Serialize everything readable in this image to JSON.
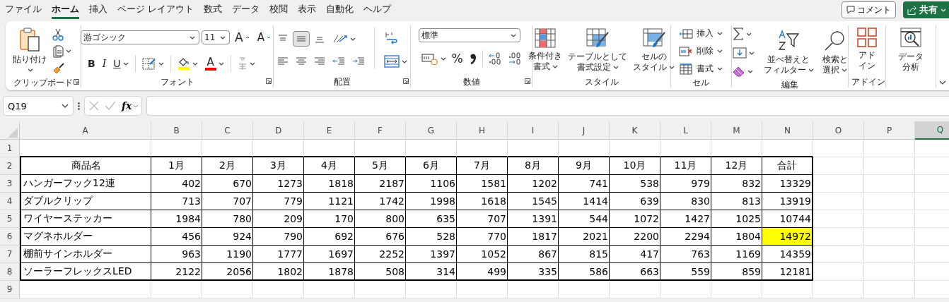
{
  "menu_tabs": [
    {
      "label": "ファイル",
      "selected": false
    },
    {
      "label": "ホーム",
      "selected": true
    },
    {
      "label": "挿入",
      "selected": false
    },
    {
      "label": "ページ レイアウト",
      "selected": false
    },
    {
      "label": "数式",
      "selected": false
    },
    {
      "label": "データ",
      "selected": false
    },
    {
      "label": "校閲",
      "selected": false
    },
    {
      "label": "表示",
      "selected": false
    },
    {
      "label": "自動化",
      "selected": false
    },
    {
      "label": "ヘルプ",
      "selected": false
    }
  ],
  "comment_button": {
    "label": "コメント"
  },
  "share_button": {
    "label": "共有"
  },
  "ribbon": [
    {
      "kind": "clipboard",
      "label": "クリップボード",
      "paste": "貼り付け"
    },
    {
      "kind": "font",
      "label": "フォント",
      "font_name": "游ゴシック",
      "font_size": "11",
      "grow": "A",
      "shrink": "A",
      "bold": "B",
      "italic": "I",
      "underline": "U",
      "fill_color": {
        "color": "#ffff00"
      },
      "font_color": {
        "glyph": "A",
        "color": "#ff0000"
      }
    },
    {
      "kind": "alignment",
      "label": "配置",
      "vertical": [
        {
          "selected": false
        },
        {
          "selected": true
        },
        {
          "selected": false
        }
      ]
    },
    {
      "kind": "number",
      "label": "数値",
      "format": "標準",
      "percent": "%"
    },
    {
      "kind": "styles",
      "label": "スタイル",
      "buttons": [
        {
          "lines": [
            "条件付き",
            "書式"
          ],
          "dropdown": true
        },
        {
          "lines": [
            "テーブルとして",
            "書式設定"
          ],
          "dropdown": true
        },
        {
          "lines": [
            "セルの",
            "スタイル"
          ],
          "dropdown": true
        }
      ]
    },
    {
      "kind": "cells",
      "label": "セル",
      "buttons": [
        "挿入",
        "削除",
        "書式"
      ]
    },
    {
      "kind": "editing",
      "label": "編集",
      "buttons": [
        {
          "lines": [
            "並べ替えと",
            "フィルター"
          ],
          "dropdown": true
        },
        {
          "lines": [
            "検索と",
            "選択"
          ],
          "dropdown": true
        }
      ]
    },
    {
      "kind": "addins",
      "label": "アドイン",
      "buttons": [
        {
          "lines": [
            "アド",
            "イン"
          ],
          "dropdown": false
        }
      ]
    },
    {
      "kind": "analysis",
      "buttons": [
        {
          "lines": [
            "データ",
            "分析"
          ],
          "dropdown": false
        }
      ]
    }
  ],
  "formula_bar": {
    "name_box": "Q19",
    "function_label": "fx"
  },
  "sheet": {
    "columns": [
      {
        "label": "A",
        "selected": false
      },
      {
        "label": "B",
        "selected": false
      },
      {
        "label": "C",
        "selected": false
      },
      {
        "label": "D",
        "selected": false
      },
      {
        "label": "E",
        "selected": false
      },
      {
        "label": "F",
        "selected": false
      },
      {
        "label": "G",
        "selected": false
      },
      {
        "label": "H",
        "selected": false
      },
      {
        "label": "I",
        "selected": false
      },
      {
        "label": "J",
        "selected": false
      },
      {
        "label": "K",
        "selected": false
      },
      {
        "label": "L",
        "selected": false
      },
      {
        "label": "M",
        "selected": false
      },
      {
        "label": "N",
        "selected": false
      },
      {
        "label": "O",
        "selected": false
      },
      {
        "label": "P",
        "selected": false
      },
      {
        "label": "Q",
        "selected": true
      }
    ],
    "rows": [
      "1",
      "2",
      "3",
      "4",
      "5",
      "6",
      "7",
      "8",
      "9"
    ],
    "table": {
      "header": [
        "商品名",
        "1月",
        "2月",
        "3月",
        "4月",
        "5月",
        "6月",
        "7月",
        "8月",
        "9月",
        "10月",
        "11月",
        "12月",
        "合計"
      ],
      "rows": [
        {
          "name": "ハンガーフック12連",
          "values": [
            "402",
            "670",
            "1273",
            "1818",
            "2187",
            "1106",
            "1581",
            "1202",
            "741",
            "538",
            "979",
            "832"
          ],
          "total": "13329",
          "highlighted": false
        },
        {
          "name": "ダブルクリップ",
          "values": [
            "713",
            "707",
            "779",
            "1121",
            "1742",
            "1998",
            "1618",
            "1545",
            "1414",
            "639",
            "830",
            "813"
          ],
          "total": "13919",
          "highlighted": false
        },
        {
          "name": "ワイヤーステッカー",
          "values": [
            "1984",
            "780",
            "209",
            "170",
            "800",
            "635",
            "707",
            "1391",
            "544",
            "1072",
            "1427",
            "1025"
          ],
          "total": "10744",
          "highlighted": false
        },
        {
          "name": "マグネホルダー",
          "values": [
            "456",
            "924",
            "790",
            "692",
            "676",
            "528",
            "770",
            "1817",
            "2021",
            "2200",
            "2294",
            "1804"
          ],
          "total": "14972",
          "highlighted": true
        },
        {
          "name": "棚前サインホルダー",
          "values": [
            "963",
            "1190",
            "1777",
            "1697",
            "2252",
            "1397",
            "1052",
            "867",
            "815",
            "417",
            "763",
            "1169"
          ],
          "total": "14359",
          "highlighted": false
        },
        {
          "name": "ソーラーフレックスLED",
          "values": [
            "2122",
            "2056",
            "1802",
            "1878",
            "508",
            "314",
            "499",
            "335",
            "586",
            "663",
            "559",
            "859"
          ],
          "total": "12181",
          "highlighted": false
        }
      ]
    }
  }
}
